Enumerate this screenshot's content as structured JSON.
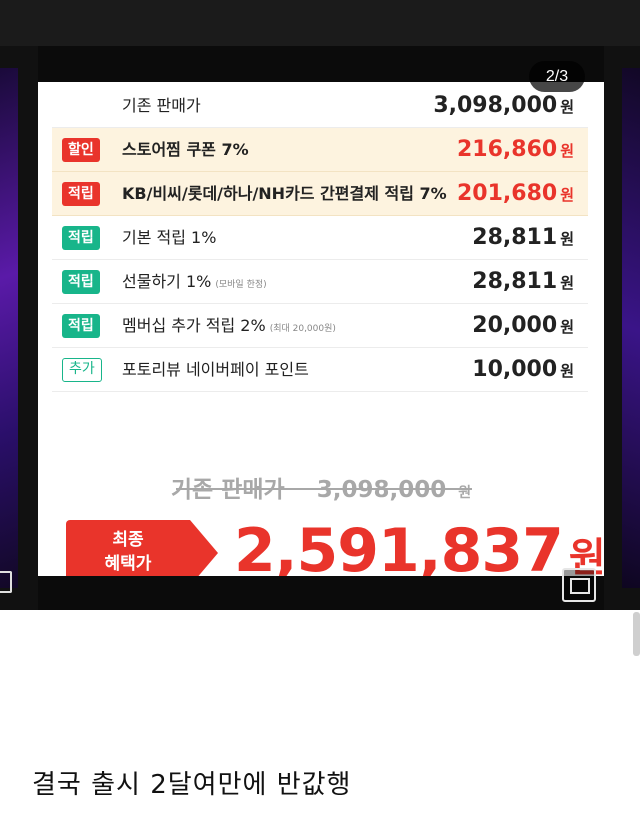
{
  "counter": "2/3",
  "rows": [
    {
      "badge": "",
      "badge_style": "none",
      "label": "기존 판매가",
      "sub": "",
      "amount": "3,098,000",
      "won": "원",
      "highlight": false,
      "amount_red": false
    },
    {
      "badge": "할인",
      "badge_style": "red",
      "label": "스토어찜 쿠폰 7%",
      "sub": "",
      "amount": "216,860",
      "won": "원",
      "highlight": true,
      "amount_red": true
    },
    {
      "badge": "적립",
      "badge_style": "red",
      "label": "KB/비씨/롯데/하나/NH카드 간편결제 적립 7%",
      "sub": "",
      "amount": "201,680",
      "won": "원",
      "highlight": true,
      "amount_red": true
    },
    {
      "badge": "적립",
      "badge_style": "green",
      "label": "기본 적립 1%",
      "sub": "",
      "amount": "28,811",
      "won": "원",
      "highlight": false,
      "amount_red": false
    },
    {
      "badge": "적립",
      "badge_style": "green",
      "label": "선물하기 1%",
      "sub": "(모바일 한정)",
      "amount": "28,811",
      "won": "원",
      "highlight": false,
      "amount_red": false
    },
    {
      "badge": "적립",
      "badge_style": "green",
      "label": "멤버십 추가 적립 2%",
      "sub": "(최대 20,000원)",
      "amount": "20,000",
      "won": "원",
      "highlight": false,
      "amount_red": false
    },
    {
      "badge": "추가",
      "badge_style": "outline",
      "label": "포토리뷰 네이버페이 포인트",
      "sub": "",
      "amount": "10,000",
      "won": "원",
      "highlight": false,
      "amount_red": false
    }
  ],
  "original": {
    "label": "기존 판매가",
    "amount": "3,098,000",
    "won": "원"
  },
  "final": {
    "badge_line1": "최종",
    "badge_line2": "혜택가",
    "amount": "2,591,837",
    "won": "원"
  },
  "caption": "결국 출시 2달여만에 반값행",
  "icons": {
    "gallery": "gallery-icon"
  },
  "colors": {
    "red": "#e9342b",
    "green": "#18b58a",
    "highlight": "#fdf3df"
  }
}
